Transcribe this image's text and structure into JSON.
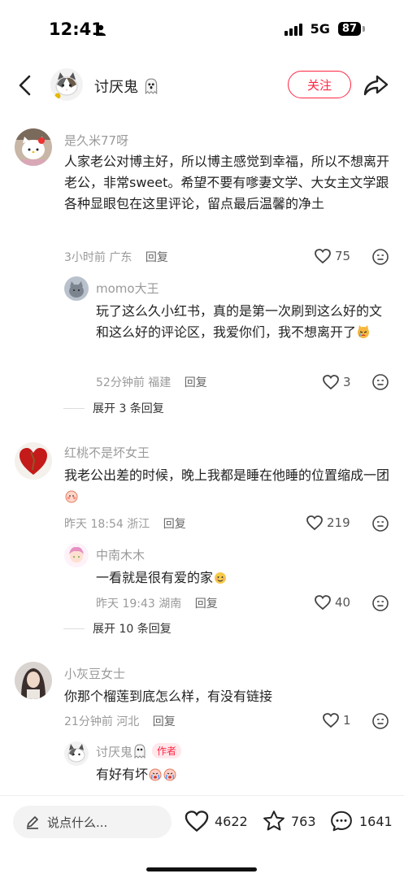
{
  "status_bar": {
    "time": "12:41",
    "network": "5G",
    "battery": "87"
  },
  "nav": {
    "author_name": "讨厌鬼",
    "follow_label": "关注"
  },
  "comments": [
    {
      "user": "是久米77呀",
      "text": "人家老公对博主好，所以博主感觉到幸福，所以不想离开老公，非常sweet。希望不要有嗲妻文学、大女主文学跟各种显眼包在这里评论，留点最后温馨的净土",
      "time": "3小时前",
      "location": "广东",
      "reply_label": "回复",
      "likes": "75",
      "reply": {
        "user": "momo大王",
        "text": "玩了这么久小红书，真的是第一次刷到这么好的文和这么好的评论区，我爱你们，我不想离开了",
        "time": "52分钟前",
        "location": "福建",
        "reply_label": "回复",
        "likes": "3"
      },
      "expand_label": "展开 3 条回复"
    },
    {
      "user": "红桃不是坏女王",
      "text": "我老公出差的时候，晚上我都是睡在他睡的位置缩成一团",
      "time": "昨天 18:54",
      "location": "浙江",
      "reply_label": "回复",
      "likes": "219",
      "reply": {
        "user": "中南木木",
        "text": "一看就是很有爱的家",
        "time": "昨天 19:43",
        "location": "湖南",
        "reply_label": "回复",
        "likes": "40"
      },
      "expand_label": "展开 10 条回复"
    },
    {
      "user": "小灰豆女士",
      "text": "你那个榴莲到底怎么样，有没有链接",
      "time": "21分钟前",
      "location": "河北",
      "reply_label": "回复",
      "likes": "1",
      "reply": {
        "user": "讨厌鬼",
        "author_tag": "作者",
        "text": "有好有坏"
      }
    }
  ],
  "bottom_bar": {
    "input_placeholder": "说点什么...",
    "like_count": "4622",
    "collect_count": "763",
    "comment_count": "1641"
  },
  "colors": {
    "accent": "#ff2442",
    "meta_gray": "#9a9a9a"
  },
  "icons": [
    "back-icon",
    "share-icon",
    "ghost-emoji-icon",
    "heart-icon",
    "dislike-face-icon",
    "star-icon",
    "comment-bubble-icon",
    "pen-icon"
  ]
}
